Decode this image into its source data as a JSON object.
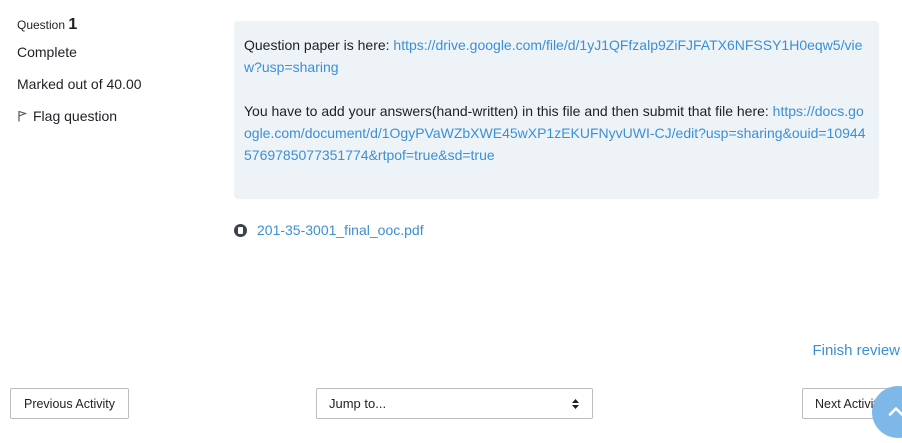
{
  "question_info": {
    "number_label": "Question",
    "number": "1",
    "state": "Complete",
    "grade": "Marked out of 40.00",
    "flag_label": "Flag question"
  },
  "question_text": {
    "paragraph1_prefix": "Question paper is here:",
    "paragraph1_link": "https://drive.google.com/file/d/1yJ1QFfzalp9ZiFJFATX6NFSSY1H0eqw5/view?usp=sharing",
    "paragraph2_prefix": "You have to add your answers(hand-written) in this file and then submit that file here:",
    "paragraph2_link": "https://docs.google.com/document/d/1OgyPVaWZbXWE45wXP1zEKUFNyvUWI-CJ/edit?usp=sharing&ouid=109445769785077351774&rtpof=true&sd=true"
  },
  "attachment": {
    "filename": "201-35-3001_final_ooc.pdf"
  },
  "finish_review_label": "Finish review",
  "navigation": {
    "previous_label": "Previous Activity",
    "jump_label": "Jump to...",
    "next_label": "Next Activity"
  },
  "colors": {
    "link": "#3b8fd6",
    "content_background": "#eef3f8",
    "fab_background": "#7eb8e8"
  }
}
